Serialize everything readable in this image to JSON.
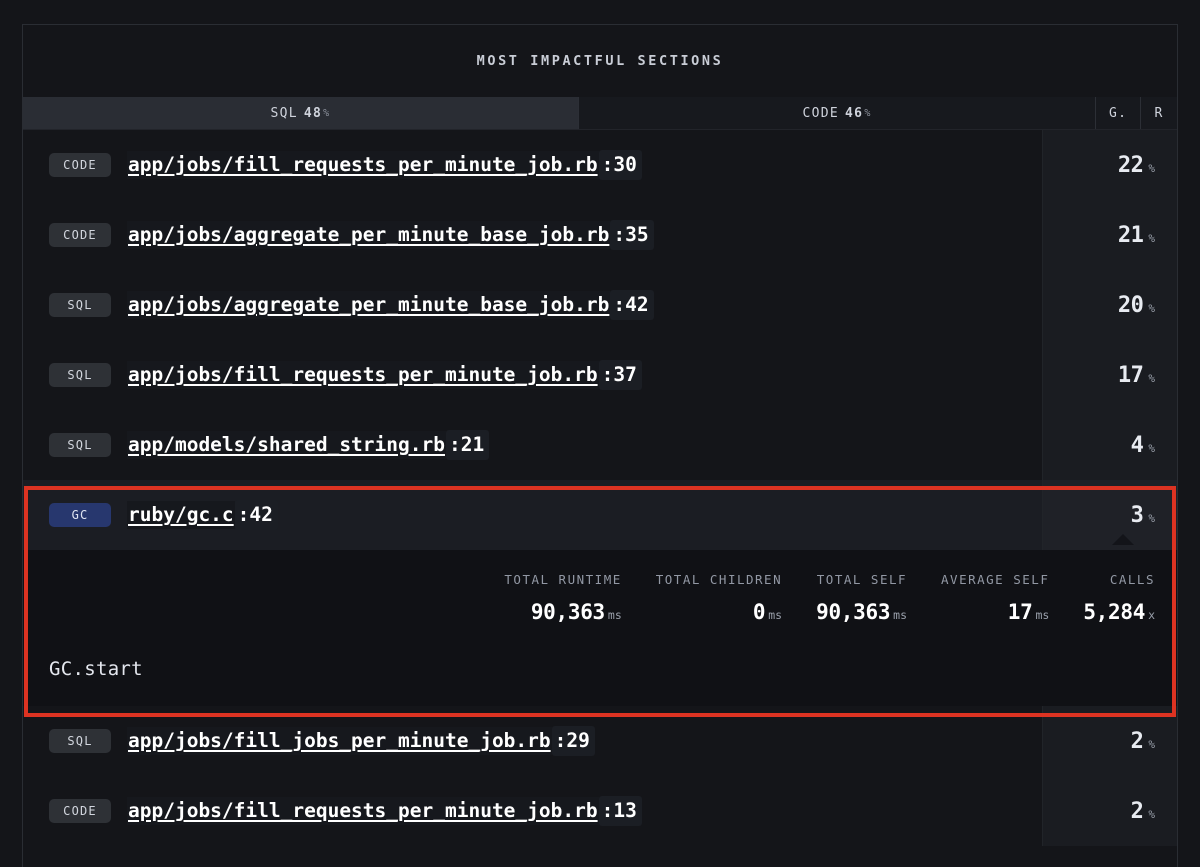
{
  "header": {
    "title": "MOST IMPACTFUL SECTIONS"
  },
  "tabs": [
    {
      "name": "SQL",
      "pct": "48",
      "symbol": "%",
      "active": true
    },
    {
      "name": "CODE",
      "pct": "46",
      "symbol": "%",
      "active": false
    },
    {
      "name": "G.",
      "pct": "",
      "symbol": "",
      "active": false
    },
    {
      "name": "R",
      "pct": "",
      "symbol": "",
      "active": false
    }
  ],
  "rows": [
    {
      "kind": "CODE",
      "path": "app/jobs/fill_requests_per_minute_job.rb",
      "line": ":30",
      "pct": "22",
      "symbol": "%"
    },
    {
      "kind": "CODE",
      "path": "app/jobs/aggregate_per_minute_base_job.rb",
      "line": ":35",
      "pct": "21",
      "symbol": "%"
    },
    {
      "kind": "SQL",
      "path": "app/jobs/aggregate_per_minute_base_job.rb",
      "line": ":42",
      "pct": "20",
      "symbol": "%"
    },
    {
      "kind": "SQL",
      "path": "app/jobs/fill_requests_per_minute_job.rb",
      "line": ":37",
      "pct": "17",
      "symbol": "%"
    },
    {
      "kind": "SQL",
      "path": "app/models/shared_string.rb",
      "line": ":21",
      "pct": "4",
      "symbol": "%"
    },
    {
      "kind": "GC",
      "path": "ruby/gc.c",
      "line": ":42",
      "pct": "3",
      "symbol": "%"
    },
    {
      "kind": "SQL",
      "path": "app/jobs/fill_jobs_per_minute_job.rb",
      "line": ":29",
      "pct": "2",
      "symbol": "%"
    },
    {
      "kind": "CODE",
      "path": "app/jobs/fill_requests_per_minute_job.rb",
      "line": ":13",
      "pct": "2",
      "symbol": "%"
    }
  ],
  "detail": {
    "metrics": [
      {
        "label": "TOTAL RUNTIME",
        "value": "90,363",
        "unit": "ms"
      },
      {
        "label": "TOTAL CHILDREN",
        "value": "0",
        "unit": "ms"
      },
      {
        "label": "TOTAL SELF",
        "value": "90,363",
        "unit": "ms"
      },
      {
        "label": "AVERAGE SELF",
        "value": "17",
        "unit": "ms"
      },
      {
        "label": "CALLS",
        "value": "5,284",
        "unit": "x"
      }
    ],
    "function": "GC.start"
  },
  "colors": {
    "page_background": "#141519",
    "card_background": "#141519",
    "highlight_border": "#dd3322",
    "badge_default": "#2e3136",
    "badge_gc": "#27376e",
    "tab_active": "#2a2d34",
    "text_primary": "#ffffff",
    "text_muted": "#9aa0ab"
  }
}
